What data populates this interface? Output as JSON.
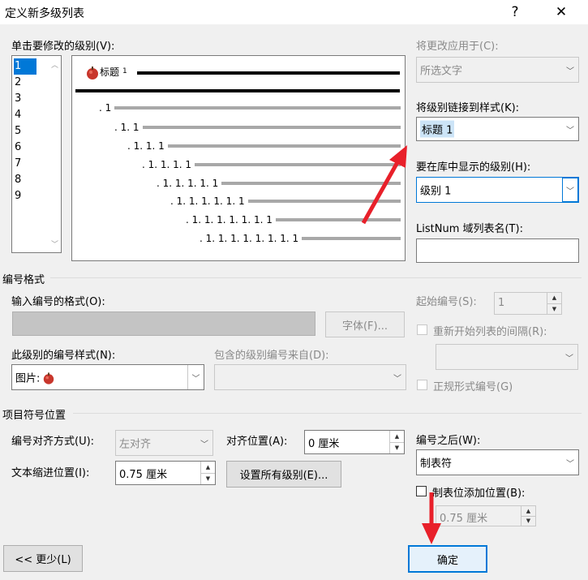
{
  "window": {
    "title": "定义新多级列表",
    "help": "?",
    "close": "✕"
  },
  "level_section": {
    "label": "单击要修改的级别(V):",
    "levels": [
      "1",
      "2",
      "3",
      "4",
      "5",
      "6",
      "7",
      "8",
      "9"
    ],
    "selected": "1"
  },
  "preview": {
    "heading_label": "标题",
    "heading_num": "1",
    "rows": [
      ". 1",
      ". 1. 1",
      ". 1. 1. 1",
      ". 1. 1. 1. 1",
      ". 1. 1. 1. 1. 1",
      ". 1. 1. 1. 1. 1. 1",
      ". 1. 1. 1. 1. 1. 1. 1",
      ". 1. 1. 1. 1. 1. 1. 1. 1"
    ]
  },
  "apply_to": {
    "label": "将更改应用于(C):",
    "value": "所选文字"
  },
  "link_style": {
    "label": "将级别链接到样式(K):",
    "value": "标题 1"
  },
  "gallery_level": {
    "label": "要在库中显示的级别(H):",
    "value": "级别 1"
  },
  "listnum": {
    "label": "ListNum 域列表名(T):",
    "value": ""
  },
  "number_format": {
    "group_title": "编号格式",
    "input_label": "输入编号的格式(O):",
    "font_button": "字体(F)...",
    "start_label": "起始编号(S):",
    "start_value": "1",
    "restart_label": "重新开始列表的间隔(R):",
    "style_label": "此级别的编号样式(N):",
    "style_value": "图片:",
    "include_label": "包含的级别编号来自(D):",
    "legal_label": "正规形式编号(G)"
  },
  "position": {
    "group_title": "项目符号位置",
    "align_label": "编号对齐方式(U):",
    "align_value": "左对齐",
    "align_at_label": "对齐位置(A):",
    "align_at_value": "0 厘米",
    "indent_label": "文本缩进位置(I):",
    "indent_value": "0.75 厘米",
    "set_all_button": "设置所有级别(E)...",
    "follow_label": "编号之后(W):",
    "follow_value": "制表符",
    "tab_add_label": "制表位添加位置(B):",
    "tab_add_value": "0.75 厘米"
  },
  "footer": {
    "less_button": "<< 更少(L)",
    "ok_button": "确定"
  },
  "colors": {
    "accent": "#0078d7",
    "arrow": "#e8202a"
  }
}
